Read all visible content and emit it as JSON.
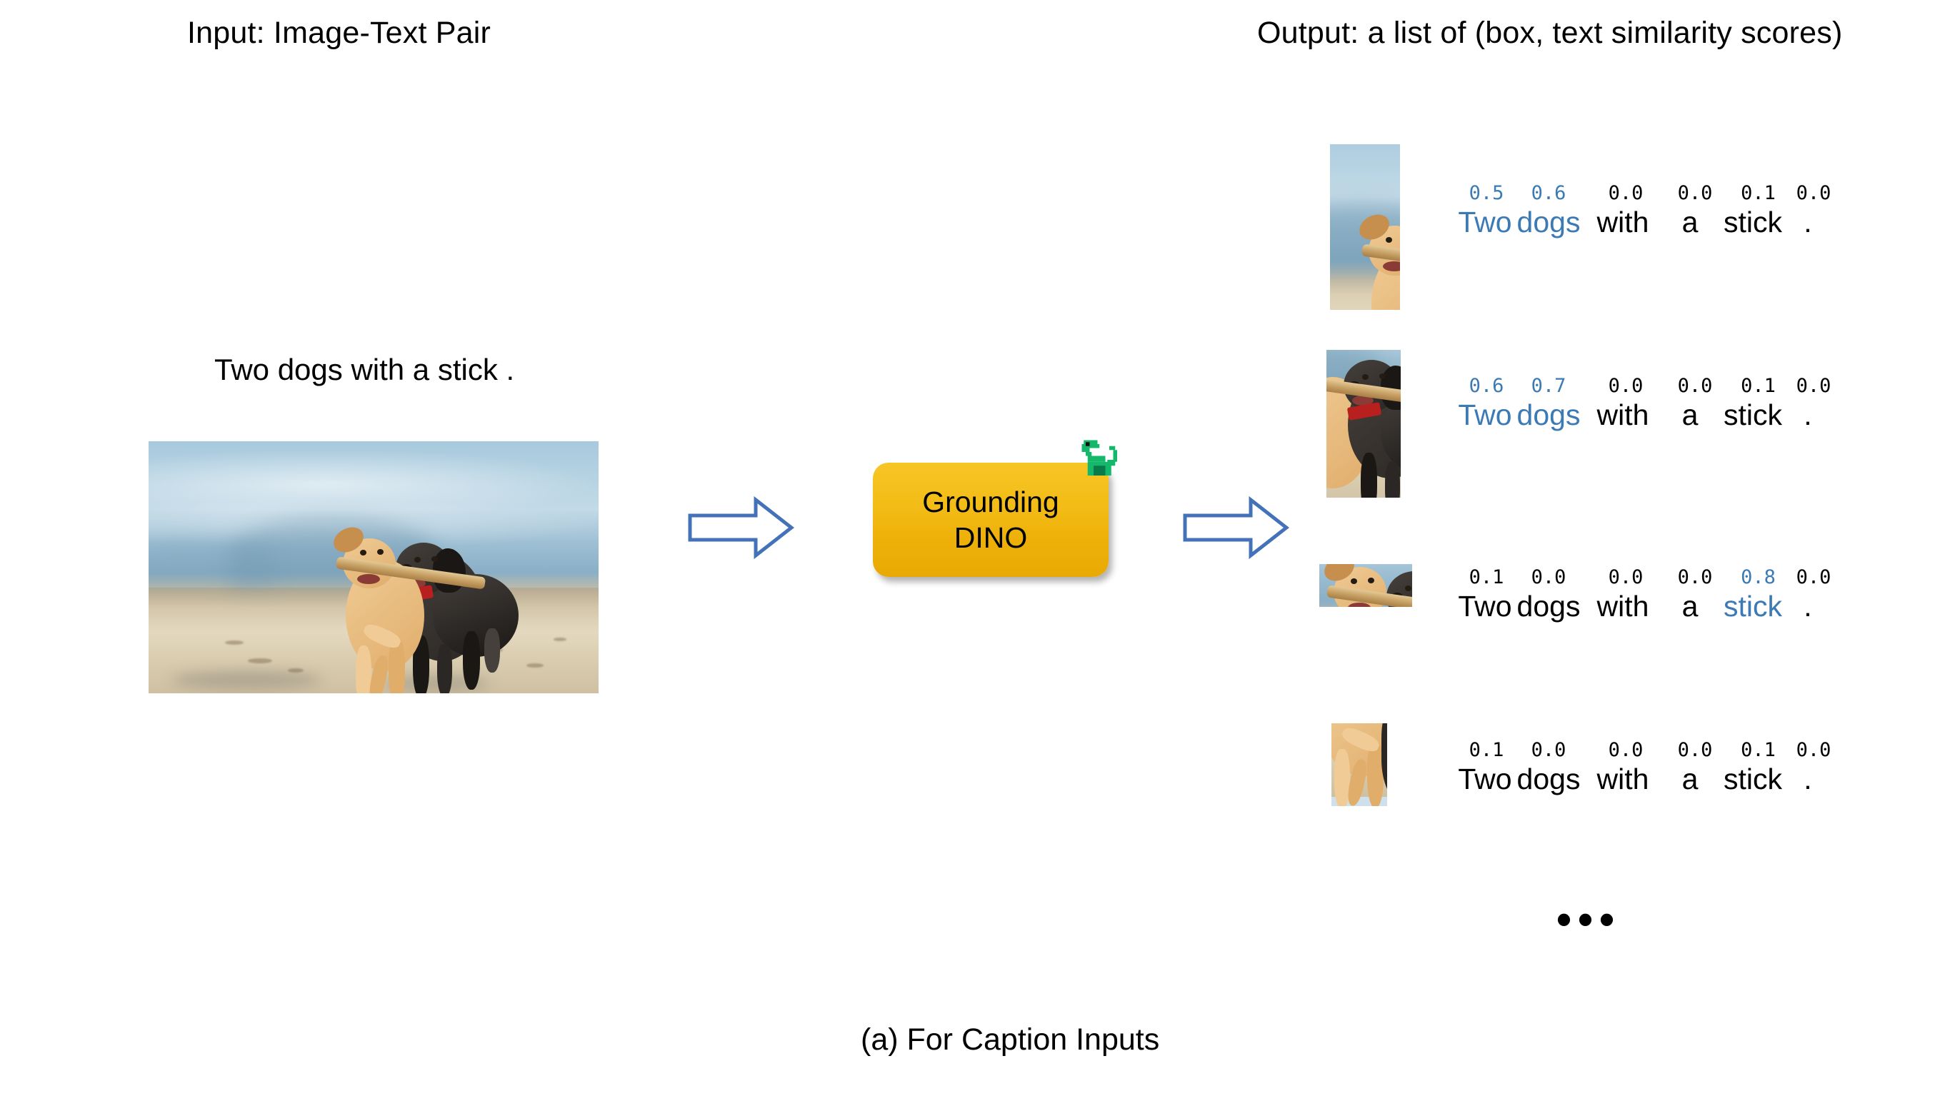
{
  "headers": {
    "input": "Input: Image-Text Pair",
    "output": "Output: a list of (box, text similarity scores)"
  },
  "figure_caption": "(a) For Caption Inputs",
  "input": {
    "caption_text": "Two dogs with a stick .",
    "photo_alt": "two dogs running on a beach carrying a stick"
  },
  "model": {
    "label_line1": "Grounding",
    "label_line2": "DINO",
    "icon": "dinosaur-icon",
    "box_color": "#f2bb14",
    "icon_color": "#13b86a"
  },
  "arrows": {
    "left_arrow": "arrow-right-icon",
    "right_arrow": "arrow-right-icon",
    "color": "#4472b8"
  },
  "colors": {
    "highlight_blue": "#3b7ab5",
    "text_black": "#000000"
  },
  "output": {
    "tokens": [
      "Two",
      "dogs",
      "with",
      "a",
      "stick",
      "."
    ],
    "rows": [
      {
        "thumb_name": "tan-dog-crop",
        "scores": [
          "0.5",
          "0.6",
          "0.0",
          "0.0",
          "0.1",
          "0.0"
        ],
        "score_highlights": [
          true,
          true,
          false,
          false,
          false,
          false
        ],
        "word_highlights": [
          true,
          true,
          false,
          false,
          false,
          false
        ]
      },
      {
        "thumb_name": "black-dog-crop",
        "scores": [
          "0.6",
          "0.7",
          "0.0",
          "0.0",
          "0.1",
          "0.0"
        ],
        "score_highlights": [
          true,
          true,
          false,
          false,
          false,
          false
        ],
        "word_highlights": [
          true,
          true,
          false,
          false,
          false,
          false
        ]
      },
      {
        "thumb_name": "stick-crop",
        "scores": [
          "0.1",
          "0.0",
          "0.0",
          "0.0",
          "0.8",
          "0.0"
        ],
        "score_highlights": [
          false,
          false,
          false,
          false,
          true,
          false
        ],
        "word_highlights": [
          false,
          false,
          false,
          false,
          true,
          false
        ]
      },
      {
        "thumb_name": "dog-legs-crop",
        "scores": [
          "0.1",
          "0.0",
          "0.0",
          "0.0",
          "0.1",
          "0.0"
        ],
        "score_highlights": [
          false,
          false,
          false,
          false,
          false,
          false
        ],
        "word_highlights": [
          false,
          false,
          false,
          false,
          false,
          false
        ]
      }
    ],
    "ellipsis": "•••"
  }
}
